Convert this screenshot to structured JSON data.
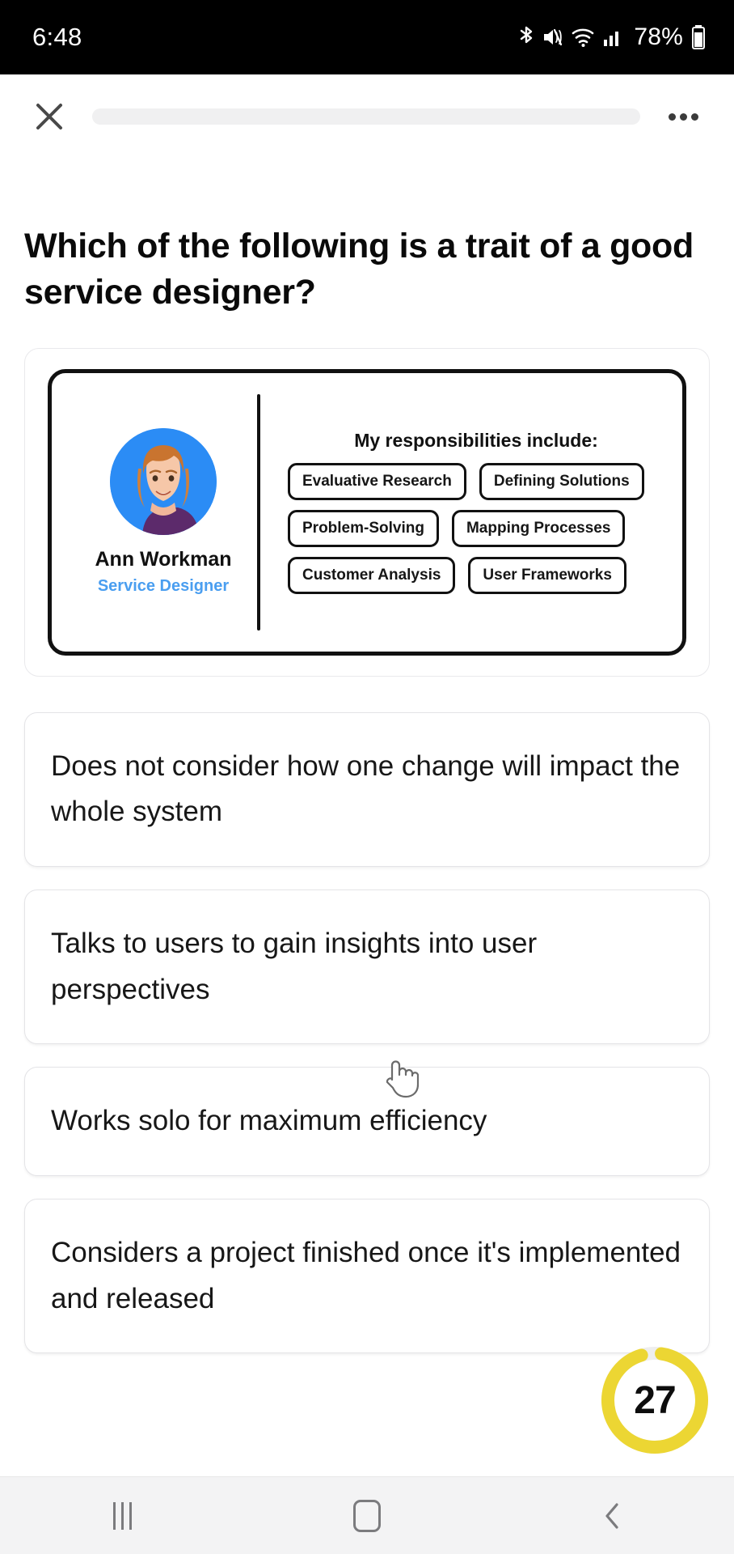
{
  "status_bar": {
    "time": "6:48",
    "battery_percent": "78%",
    "icons": [
      "bluetooth-icon",
      "mute-icon",
      "wifi-icon",
      "cellular-signal-icon",
      "battery-icon"
    ]
  },
  "header": {
    "close_icon": "close-icon",
    "more_icon": "more-options-icon",
    "progress_value": 0
  },
  "question": {
    "text": "Which of the following is a trait of a good service designer?"
  },
  "persona_card": {
    "name": "Ann Workman",
    "role": "Service Designer",
    "responsibilities_title": "My responsibilities include:",
    "tags": [
      "Evaluative Research",
      "Defining Solutions",
      "Problem-Solving",
      "Mapping Processes",
      "Customer Analysis",
      "User Frameworks"
    ]
  },
  "answers": [
    {
      "label": "Does not consider how one change will impact the whole system"
    },
    {
      "label": "Talks to users to gain insights into user perspectives"
    },
    {
      "label": "Works solo for maximum efficiency"
    },
    {
      "label": "Considers a project finished once it's implemented and released"
    }
  ],
  "timer": {
    "seconds": "27",
    "ring_color": "#ecd633",
    "progress_fraction": 0.93
  },
  "nav_bar": {
    "recents_icon": "recents-icon",
    "home_icon": "home-icon",
    "back_icon": "back-icon"
  },
  "colors": {
    "accent_blue": "#2b8cf5",
    "role_blue": "#4a9ef0",
    "timer_yellow": "#ecd633",
    "card_border": "#e4e4e7"
  }
}
